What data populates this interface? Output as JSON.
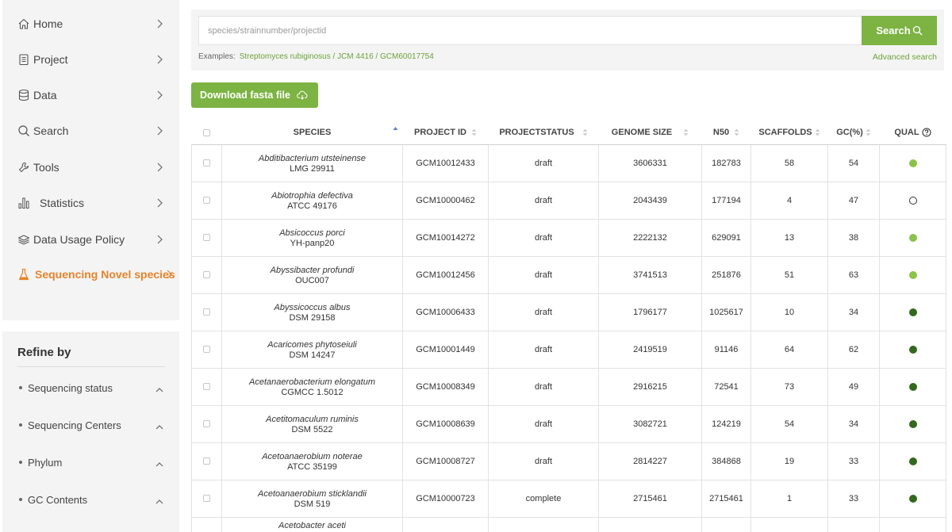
{
  "nav": {
    "items": [
      {
        "label": "Home",
        "icon": "home-icon"
      },
      {
        "label": "Project",
        "icon": "project-icon"
      },
      {
        "label": "Data",
        "icon": "database-icon"
      },
      {
        "label": "Search",
        "icon": "search-icon"
      },
      {
        "label": "Tools",
        "icon": "tools-icon"
      },
      {
        "label": "Statistics",
        "icon": "statistics-icon"
      },
      {
        "label": "Data Usage Policy",
        "icon": "policy-icon"
      },
      {
        "label": "Sequencing Novel species",
        "icon": "flask-icon",
        "active": true
      }
    ]
  },
  "refine": {
    "title": "Refine by",
    "items": [
      {
        "label": "Sequencing status"
      },
      {
        "label": "Sequencing Centers"
      },
      {
        "label": "Phylum"
      },
      {
        "label": "GC Contents"
      }
    ]
  },
  "search": {
    "placeholder": "species/strainnumber/projectid",
    "button_label": "Search",
    "examples_label": "Examples:",
    "examples_text": "Streptomyces rubiginosus / JCM 4416 / GCM60017754",
    "advanced_label": "Advanced search"
  },
  "download": {
    "label": "Download fasta file"
  },
  "colors": {
    "accent": "#7cb342",
    "active_nav": "#e8832a",
    "qual_light": "#8bc34a",
    "qual_dark": "#33691e"
  },
  "table": {
    "headers": {
      "species": "SPECIES",
      "project_id": "PROJECT ID",
      "project_status": "PROJECTSTATUS",
      "genome_size": "GENOME SIZE",
      "n50": "N50",
      "scaffolds": "SCAFFOLDS",
      "gc": "GC(%)",
      "qual": "QUAL"
    },
    "rows": [
      {
        "name": "Abditibacterium utsteinense",
        "strain": "LMG 29911",
        "project_id": "GCM10012433",
        "status": "draft",
        "genome_size": "3606331",
        "n50": "182783",
        "scaffolds": "58",
        "gc": "54",
        "qual": "light"
      },
      {
        "name": "Abiotrophia defectiva",
        "strain": "ATCC 49176",
        "project_id": "GCM10000462",
        "status": "draft",
        "genome_size": "2043439",
        "n50": "177194",
        "scaffolds": "4",
        "gc": "47",
        "qual": "empty"
      },
      {
        "name": "Absicoccus porci",
        "strain": "YH-panp20",
        "project_id": "GCM10014272",
        "status": "draft",
        "genome_size": "2222132",
        "n50": "629091",
        "scaffolds": "13",
        "gc": "38",
        "qual": "light"
      },
      {
        "name": "Abyssibacter profundi",
        "strain": "OUC007",
        "project_id": "GCM10012456",
        "status": "draft",
        "genome_size": "3741513",
        "n50": "251876",
        "scaffolds": "51",
        "gc": "63",
        "qual": "light"
      },
      {
        "name": "Abyssicoccus albus",
        "strain": "DSM 29158",
        "project_id": "GCM10006433",
        "status": "draft",
        "genome_size": "1796177",
        "n50": "1025617",
        "scaffolds": "10",
        "gc": "34",
        "qual": "dark"
      },
      {
        "name": "Acaricomes phytoseiuli",
        "strain": "DSM 14247",
        "project_id": "GCM10001449",
        "status": "draft",
        "genome_size": "2419519",
        "n50": "91146",
        "scaffolds": "64",
        "gc": "62",
        "qual": "dark"
      },
      {
        "name": "Acetanaerobacterium elongatum",
        "strain": "CGMCC 1.5012",
        "project_id": "GCM10008349",
        "status": "draft",
        "genome_size": "2916215",
        "n50": "72541",
        "scaffolds": "73",
        "gc": "49",
        "qual": "dark"
      },
      {
        "name": "Acetitomaculum ruminis",
        "strain": "DSM 5522",
        "project_id": "GCM10008639",
        "status": "draft",
        "genome_size": "3082721",
        "n50": "124219",
        "scaffolds": "54",
        "gc": "34",
        "qual": "dark"
      },
      {
        "name": "Acetoanaerobium noterae",
        "strain": "ATCC 35199",
        "project_id": "GCM10008727",
        "status": "draft",
        "genome_size": "2814227",
        "n50": "384868",
        "scaffolds": "19",
        "gc": "33",
        "qual": "dark"
      },
      {
        "name": "Acetoanaerobium sticklandii",
        "strain": "DSM 519",
        "project_id": "GCM10000723",
        "status": "complete",
        "genome_size": "2715461",
        "n50": "2715461",
        "scaffolds": "1",
        "gc": "33",
        "qual": "dark"
      }
    ],
    "partial_row": {
      "name": "Acetobacter aceti"
    }
  }
}
